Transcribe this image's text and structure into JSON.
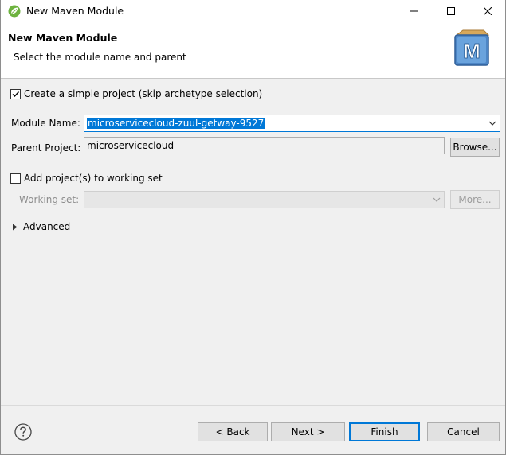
{
  "window": {
    "title": "New Maven Module",
    "minimize_icon": "minimize-icon",
    "maximize_icon": "maximize-icon",
    "close_icon": "close-icon"
  },
  "header": {
    "title": "New Maven Module",
    "description": "Select the module name and parent",
    "logo_letter": "M"
  },
  "form": {
    "simple_project_label": "Create a simple project (skip archetype selection)",
    "simple_project_checked": true,
    "module_name_label": "Module Name:",
    "module_name_value": "microservicecloud-zuul-getway-9527",
    "parent_project_label": "Parent Project:",
    "parent_project_value": "microservicecloud",
    "browse_label": "Browse...",
    "working_set_checkbox_label": "Add project(s) to working set",
    "working_set_checked": false,
    "working_set_label": "Working set:",
    "working_set_value": "",
    "more_label": "More...",
    "advanced_label": "Advanced"
  },
  "buttons": {
    "back": "< Back",
    "next": "Next >",
    "finish": "Finish",
    "cancel": "Cancel"
  },
  "colors": {
    "accent": "#0078d7",
    "spring_green": "#6db33f"
  }
}
